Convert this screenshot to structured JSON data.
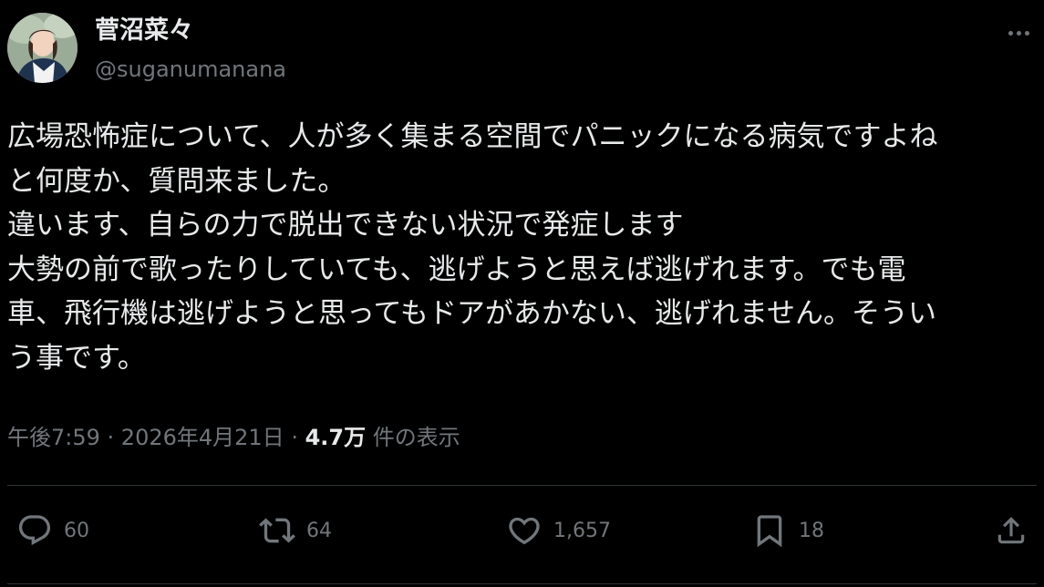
{
  "author": {
    "display_name": "菅沼菜々",
    "handle": "@suganumanana"
  },
  "post": {
    "lines": [
      "広場恐怖症について、人が多く集まる空間でパニックになる病気ですよね",
      "と何度か、質問来ました。",
      "違います、自らの力で脱出できない状況で発症します",
      "大勢の前で歌ったりしていても、逃げようと思えば逃げれます。でも電",
      "車、飛行機は逃げようと思ってもドアがあかない、逃げれません。そうい",
      "う事です。"
    ]
  },
  "meta": {
    "time": "午後7:59",
    "separator_1": " · ",
    "date": "2026年4月21日",
    "separator_2": " · ",
    "views_count": "4.7万",
    "views_label": " 件の表示"
  },
  "actions": {
    "reply_count": "60",
    "repost_count": "64",
    "like_count": "1,657",
    "bookmark_count": "18"
  },
  "icons": {
    "more": "more-horizontal-icon",
    "reply": "reply-bubble-icon",
    "repost": "repost-arrows-icon",
    "like": "heart-icon",
    "bookmark": "bookmark-icon",
    "share": "share-upload-icon"
  },
  "colors": {
    "background": "#000000",
    "primary_text": "#e7e9ea",
    "secondary_text": "#71767b",
    "divider": "#2f3336"
  }
}
